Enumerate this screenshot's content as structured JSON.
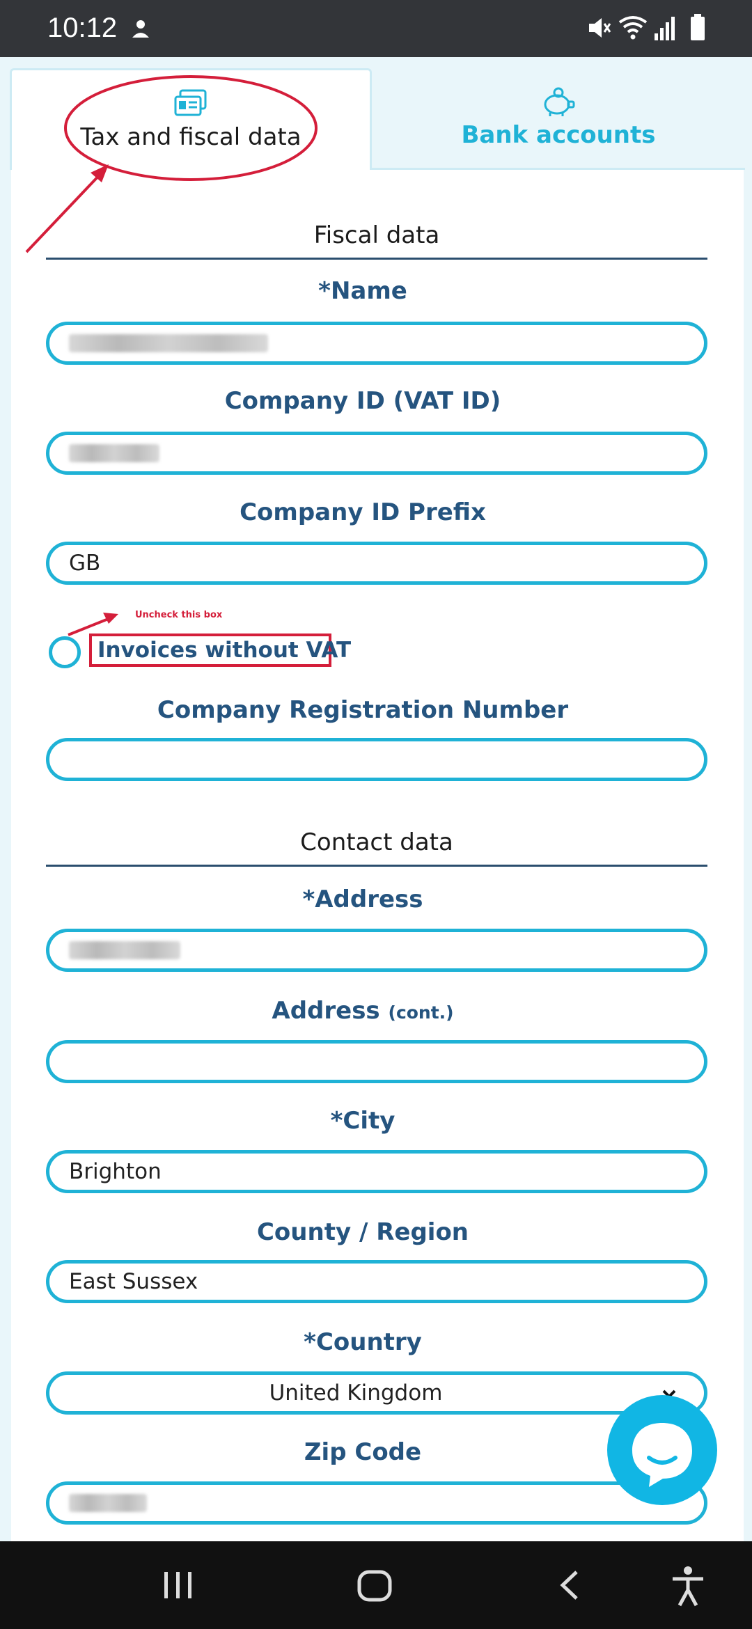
{
  "status_bar": {
    "time": "10:12",
    "icons": [
      "notification-icon",
      "mute-icon",
      "wifi-icon",
      "signal-icon",
      "battery-icon"
    ]
  },
  "tabs": [
    {
      "label": "Tax and fiscal data",
      "icon": "id-card-icon",
      "active": true
    },
    {
      "label": "Bank accounts",
      "icon": "piggy-bank-icon",
      "active": false
    }
  ],
  "fiscal_section": {
    "title": "Fiscal data",
    "name_label": "Name",
    "name_value": "",
    "company_id_label": "Company ID (VAT ID)",
    "company_id_value": "",
    "company_id_prefix_label": "Company ID Prefix",
    "company_id_prefix_value": "GB",
    "invoices_without_vat_label": "Invoices without VAT",
    "invoices_without_vat_checked": false,
    "company_reg_label": "Company Registration Number",
    "company_reg_value": ""
  },
  "annotation": {
    "note": "Uncheck this box",
    "color": "#d41e3a"
  },
  "contact_section": {
    "title": "Contact data",
    "address_label": "Address",
    "address_value": "",
    "address_cont_label": "Address",
    "address_cont_suffix": "(cont.)",
    "address_cont_value": "",
    "city_label": "City",
    "city_value": "Brighton",
    "county_label": "County / Region",
    "county_value": "East Sussex",
    "country_label": "Country",
    "country_value": "United Kingdom",
    "zip_label": "Zip Code",
    "zip_value": ""
  },
  "required_marker": "*",
  "colors": {
    "accent": "#1fb2d6",
    "label": "#25547f",
    "annotation": "#d41e3a"
  },
  "nav": [
    "recents-icon",
    "home-icon",
    "back-icon",
    "accessibility-icon"
  ]
}
